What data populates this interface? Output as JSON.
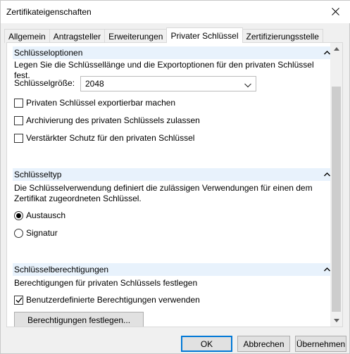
{
  "window": {
    "title": "Zertifikateigenschaften"
  },
  "tabs": [
    {
      "label": "Allgemein"
    },
    {
      "label": "Antragsteller"
    },
    {
      "label": "Erweiterungen"
    },
    {
      "label": "Privater Schlüssel",
      "active": true
    },
    {
      "label": "Zertifizierungsstelle"
    }
  ],
  "key_options": {
    "header": "Schlüsseloptionen",
    "description": "Legen Sie die Schlüssellänge und die Exportoptionen für den privaten Schlüssel fest.",
    "key_size_label": "Schlüsselgröße:",
    "key_size_value": "2048",
    "checkboxes": [
      {
        "label": "Privaten Schlüssel exportierbar machen",
        "checked": false
      },
      {
        "label": "Archivierung des privaten Schlüssels zulassen",
        "checked": false
      },
      {
        "label": "Verstärkter Schutz für den privaten Schlüssel",
        "checked": false
      }
    ]
  },
  "key_type": {
    "header": "Schlüsseltyp",
    "description_line1": "Die Schlüsselverwendung definiert die zulässigen Verwendungen für einen dem",
    "description_line2": "Zertifikat zugeordneten Schlüssel.",
    "radios": [
      {
        "label": "Austausch",
        "selected": true
      },
      {
        "label": "Signatur",
        "selected": false
      }
    ]
  },
  "key_permissions": {
    "header": "Schlüsselberechtigungen",
    "description": "Berechtigungen für privaten Schlüssels festlegen",
    "custom_checkbox_label": "Benutzerdefinierte Berechtigungen verwenden",
    "custom_checked": true,
    "set_permissions_button": "Berechtigungen festlegen..."
  },
  "footer": {
    "ok": "OK",
    "cancel": "Abbrechen",
    "apply": "Übernehmen"
  }
}
